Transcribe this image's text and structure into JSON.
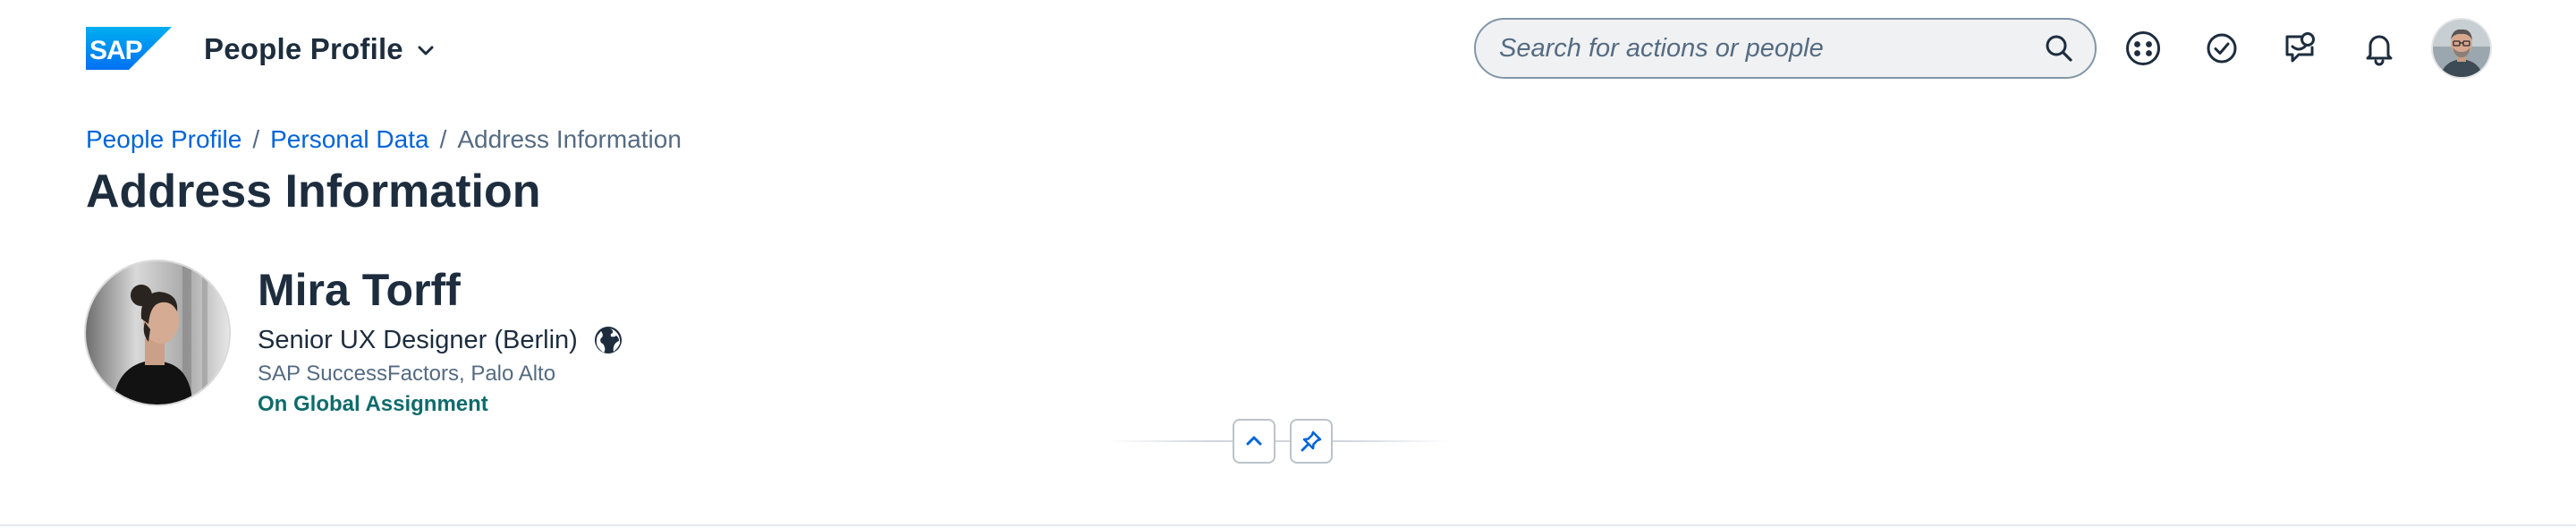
{
  "shellbar": {
    "logo": {
      "icon": "sap-logo",
      "text": "SAP",
      "color": "#0070f2"
    },
    "app_title": "People Profile",
    "app_title_icon": "chevron-down-icon",
    "search": {
      "placeholder": "Search for actions or people",
      "value": "",
      "icon": "search-icon"
    },
    "actions": [
      {
        "name": "joule-assistant",
        "icon": "ai-face-icon"
      },
      {
        "name": "tasks",
        "icon": "check-circle-icon"
      },
      {
        "name": "notifications-chat",
        "icon": "chat-bubble-icon"
      },
      {
        "name": "notifications",
        "icon": "bell-icon"
      }
    ],
    "user_avatar": {
      "icon": "user-avatar"
    }
  },
  "breadcrumb": {
    "items": [
      "People Profile",
      "Personal Data"
    ],
    "separator": "/",
    "current": "Address Information"
  },
  "page": {
    "title": "Address Information"
  },
  "employee": {
    "name": "Mira Torff",
    "role": "Senior UX Designer (Berlin)",
    "role_icon": "globe-icon",
    "company": "SAP SuccessFactors, Palo Alto",
    "status": "On Global Assignment",
    "status_color": "#0f6b6b"
  },
  "header_controls": {
    "collapse": {
      "icon": "chevron-up-icon"
    },
    "pin": {
      "icon": "pin-icon"
    }
  },
  "colors": {
    "link": "#0064d9",
    "text": "#1d2d3e",
    "muted": "#556b82"
  }
}
